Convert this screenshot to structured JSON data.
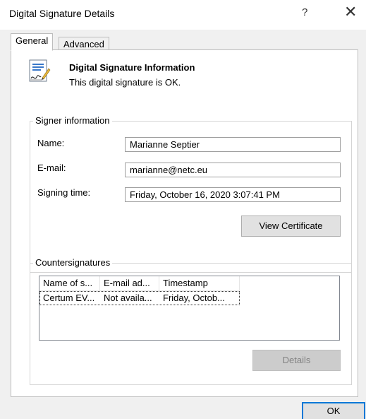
{
  "window": {
    "title": "Digital Signature Details",
    "help_label": "?",
    "close_label": "✕"
  },
  "tabs": [
    {
      "label": "General",
      "selected": true
    },
    {
      "label": "Advanced",
      "selected": false
    }
  ],
  "info": {
    "title": "Digital Signature Information",
    "status": "This digital signature is OK."
  },
  "signer": {
    "legend": "Signer information",
    "name_label": "Name:",
    "name_value": "Marianne Septier",
    "email_label": "E-mail:",
    "email_value": "marianne@netc.eu",
    "time_label": "Signing time:",
    "time_value": "Friday, October 16, 2020 3:07:41 PM",
    "view_cert_label": "View Certificate"
  },
  "countersignatures": {
    "legend": "Countersignatures",
    "columns": [
      "Name of s...",
      "E-mail ad...",
      "Timestamp"
    ],
    "rows": [
      [
        "Certum EV...",
        "Not availa...",
        "Friday, Octob..."
      ]
    ],
    "details_label": "Details",
    "details_enabled": false
  },
  "footer": {
    "ok_label": "OK"
  }
}
